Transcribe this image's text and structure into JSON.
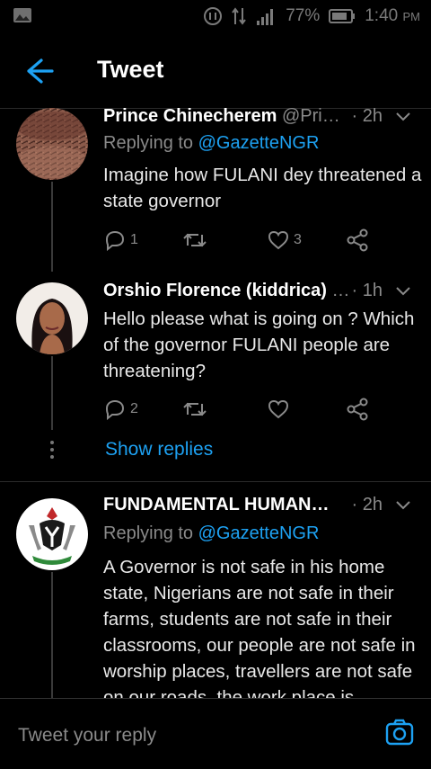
{
  "status_bar": {
    "battery": "77%",
    "time": "1:40",
    "ampm": "PM",
    "icons": [
      "image-icon",
      "alarm-icon",
      "data-arrows-icon",
      "signal-icon",
      "battery-icon"
    ]
  },
  "header": {
    "title": "Tweet",
    "back_icon": "arrow-left-icon"
  },
  "tweets": [
    {
      "name": "Prince Chinecherem",
      "handle": "@Pri…",
      "time": "· 2h",
      "replying_prefix": "Replying to ",
      "replying_to": "@GazetteNGR",
      "text": "Imagine how FULANI dey threatened a state governor",
      "reply_count": "1",
      "retweet_count": "",
      "like_count": "3"
    },
    {
      "name": "Orshio Florence (kiddrica)",
      "handle": "…",
      "time": "· 1h",
      "text": "Hello please what is going on ? Which of the governor FULANI people are threatening?",
      "reply_count": "2",
      "retweet_count": "",
      "like_count": ""
    },
    {
      "name": "FUNDAMENTAL HUMAN…",
      "handle": "",
      "time": "· 2h",
      "replying_prefix": "Replying to ",
      "replying_to": "@GazetteNGR",
      "text": "A Governor is not safe in his home state, Nigerians are not safe in their farms, students are not safe in their classrooms, our people are not safe in worship places, travellers are not safe on our roads, the work place is"
    }
  ],
  "show_replies": "Show replies",
  "reply_bar": {
    "placeholder": "Tweet your reply",
    "camera_icon": "camera-icon"
  },
  "colors": {
    "accent": "#1da1f2",
    "background": "#000000",
    "muted": "#8a8a8a"
  }
}
